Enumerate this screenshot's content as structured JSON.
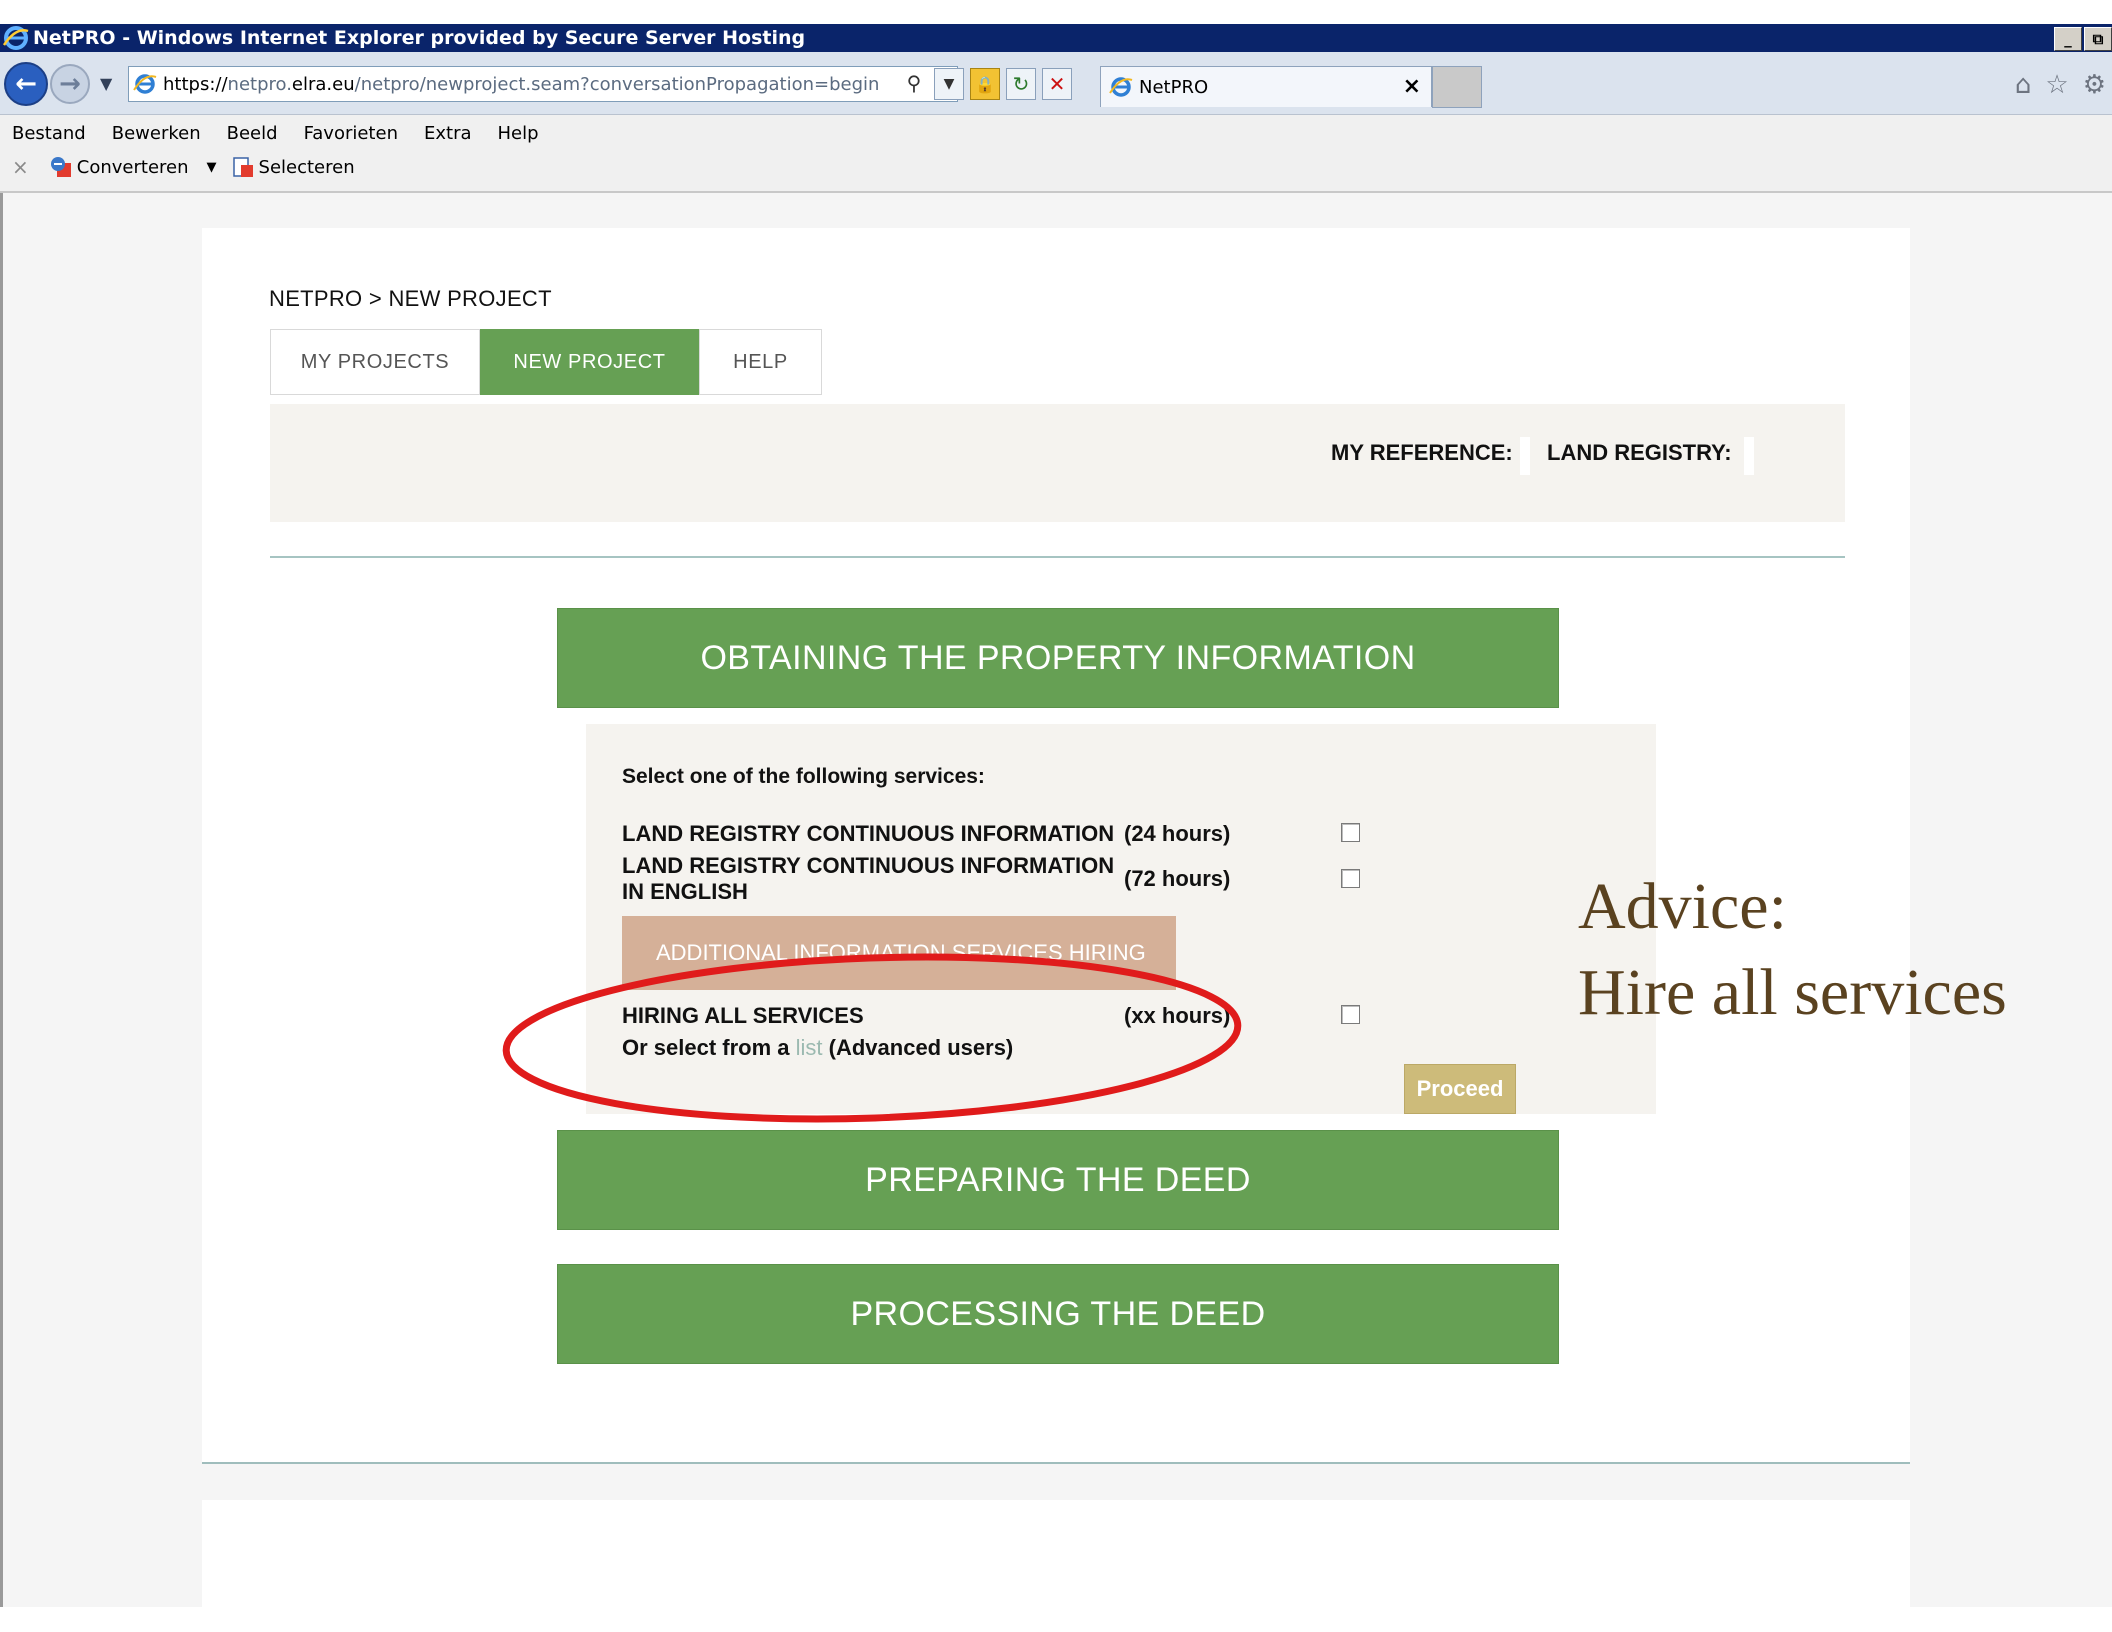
{
  "window": {
    "title": "NetPRO - Windows Internet Explorer provided by Secure Server Hosting",
    "buttons": [
      "_",
      "⧉"
    ]
  },
  "address": {
    "protocol": "https://",
    "host_pre": "netpro.",
    "host_main": "elra.eu",
    "path": "/netpro/newproject.seam?conversationPropagation=begin"
  },
  "tab": {
    "title": "NetPRO",
    "close": "×"
  },
  "menu": [
    "Bestand",
    "Bewerken",
    "Beeld",
    "Favorieten",
    "Extra",
    "Help"
  ],
  "commandbar": {
    "close": "×",
    "convert": "Converteren",
    "select": "Selecteren"
  },
  "page": {
    "breadcrumb": "NETPRO > NEW PROJECT",
    "tabs": [
      "MY PROJECTS",
      "NEW PROJECT",
      "HELP"
    ],
    "active_tab": "NEW PROJECT",
    "my_reference_label": "MY REFERENCE:",
    "land_registry_label": "LAND REGISTRY:",
    "sections": {
      "obtaining": "OBTAINING THE PROPERTY INFORMATION",
      "preparing": "PREPARING THE DEED",
      "processing": "PROCESSING THE DEED"
    },
    "services": {
      "prompt": "Select one of the following services:",
      "items": [
        {
          "name": "LAND REGISTRY CONTINUOUS INFORMATION",
          "duration": "(24 hours)",
          "checked": false
        },
        {
          "name_line1": "LAND REGISTRY CONTINUOUS INFORMATION",
          "name_line2": "IN ENGLISH",
          "duration": "(72 hours)",
          "checked": false
        }
      ],
      "additional_header": "ADDITIONAL INFORMATION SERVICES HIRING",
      "hiring_all": {
        "name": "HIRING ALL SERVICES",
        "duration": "(xx hours)",
        "checked": false
      },
      "or_select_prefix": "Or select from a ",
      "list_link": "list",
      "or_select_suffix": " (Advanced users)",
      "proceed": "Proceed"
    }
  },
  "annotation": {
    "line1": "Advice:",
    "line2": "Hire all services",
    "ellipse_color": "#e01b1b"
  },
  "colors": {
    "green": "#66a054",
    "tan": "#d5b098",
    "proceed": "#cdbb7a",
    "titlebar": "#0a246a"
  }
}
